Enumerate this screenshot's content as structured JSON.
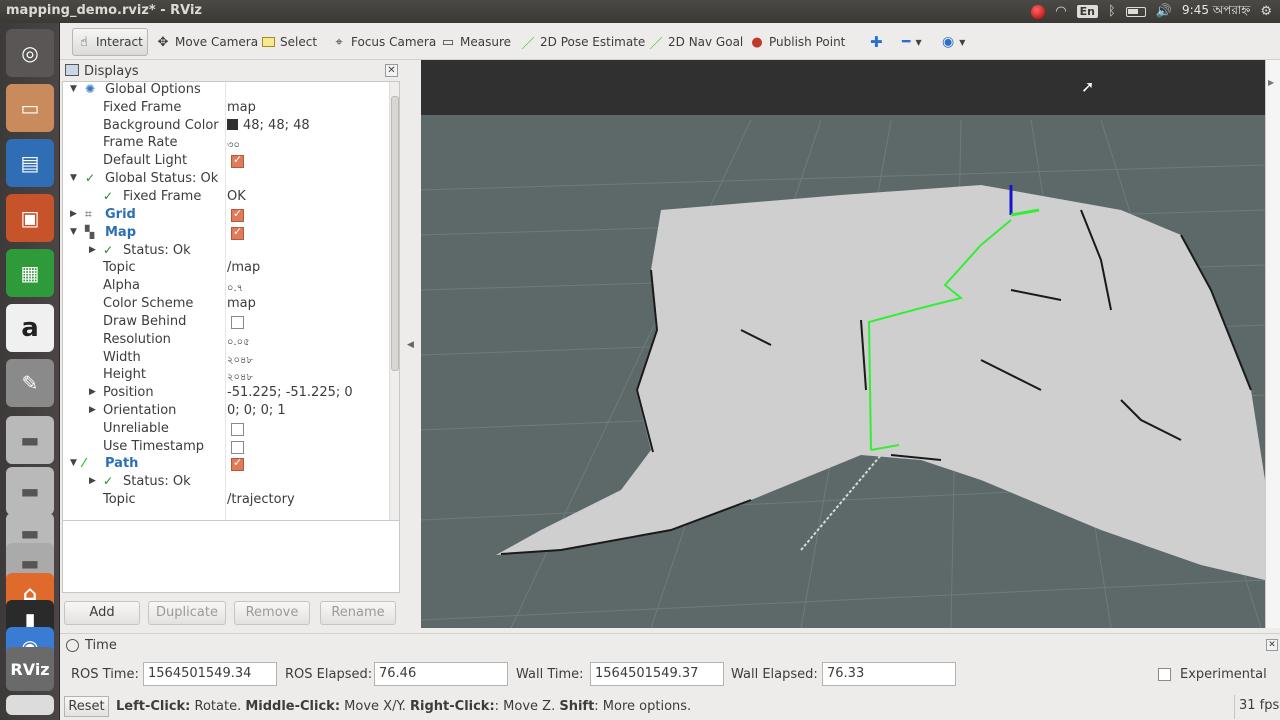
{
  "window": {
    "title": "mapping_demo.rviz* - RViz"
  },
  "tray": {
    "lang": "En",
    "clock": "9:45 অপরাহ্ন"
  },
  "launcher": {
    "items": [
      "ubuntu-dash",
      "files",
      "writer",
      "impress",
      "calc",
      "amazon",
      "system-settings",
      "disk",
      "disk",
      "disk",
      "disk",
      "software",
      "terminal",
      "browser",
      "rviz"
    ],
    "rviz_label": "RViz"
  },
  "toolbar": {
    "interact": "Interact",
    "move_camera": "Move Camera",
    "select": "Select",
    "focus_camera": "Focus Camera",
    "measure": "Measure",
    "pose_estimate": "2D Pose Estimate",
    "nav_goal": "2D Nav Goal",
    "publish_point": "Publish Point"
  },
  "displays": {
    "title": "Displays",
    "rows": [
      {
        "name": "Global Options",
        "value": ""
      },
      {
        "name": "Fixed Frame",
        "value": "map"
      },
      {
        "name": "Background Color",
        "value": "48; 48; 48"
      },
      {
        "name": "Frame Rate",
        "value": "৩০"
      },
      {
        "name": "Default Light",
        "value": ""
      },
      {
        "name": "Global Status: Ok",
        "value": ""
      },
      {
        "name": "Fixed Frame",
        "value": "OK"
      },
      {
        "name": "Grid",
        "value": ""
      },
      {
        "name": "Map",
        "value": ""
      },
      {
        "name": "Status: Ok",
        "value": ""
      },
      {
        "name": "Topic",
        "value": "/map"
      },
      {
        "name": "Alpha",
        "value": "০.৭"
      },
      {
        "name": "Color Scheme",
        "value": "map"
      },
      {
        "name": "Draw Behind",
        "value": ""
      },
      {
        "name": "Resolution",
        "value": "০.০৫"
      },
      {
        "name": "Width",
        "value": "২০৪৮"
      },
      {
        "name": "Height",
        "value": "২০৪৮"
      },
      {
        "name": "Position",
        "value": "-51.225; -51.225; 0"
      },
      {
        "name": "Orientation",
        "value": "0; 0; 0; 1"
      },
      {
        "name": "Unreliable",
        "value": ""
      },
      {
        "name": "Use Timestamp",
        "value": ""
      },
      {
        "name": "Path",
        "value": ""
      },
      {
        "name": "Status: Ok",
        "value": ""
      },
      {
        "name": "Topic",
        "value": "/trajectory"
      }
    ],
    "checks": {
      "default_light": true,
      "grid": true,
      "map": true,
      "draw_behind": false,
      "unreliable": false,
      "use_timestamp": false,
      "path": true
    },
    "buttons": {
      "add": "Add",
      "duplicate": "Duplicate",
      "remove": "Remove",
      "rename": "Rename"
    }
  },
  "time": {
    "title": "Time",
    "ros_time_label": "ROS Time:",
    "ros_time": "1564501549.34",
    "ros_elapsed_label": "ROS Elapsed:",
    "ros_elapsed": "76.46",
    "wall_time_label": "Wall Time:",
    "wall_time": "1564501549.37",
    "wall_elapsed_label": "Wall Elapsed:",
    "wall_elapsed": "76.33",
    "experimental_label": "Experimental"
  },
  "status": {
    "reset": "Reset",
    "k1": "Left-Click:",
    "t1": " Rotate. ",
    "k2": "Middle-Click:",
    "t2": " Move X/Y. ",
    "k3": "Right-Click:",
    "t3": ": Move Z. ",
    "k4": "Shift",
    "t4": ": More options.",
    "fps": "31 fps"
  },
  "colors": {
    "background": "#303030",
    "path": "#33ee33",
    "grid": "#5f6b6b",
    "free_space": "#cfcfcf"
  }
}
